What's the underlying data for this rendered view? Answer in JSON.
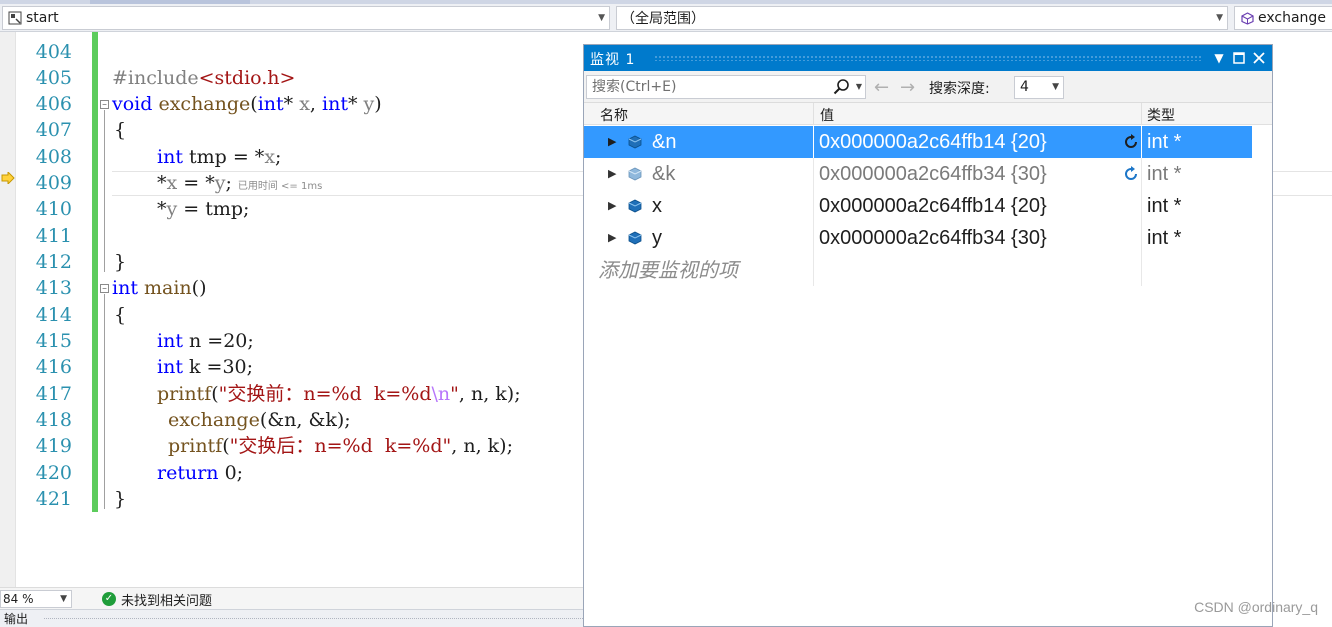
{
  "navbar": {
    "project_combo": "start",
    "scope_combo": "（全局范围）",
    "member_combo": "exchange"
  },
  "editor": {
    "line_numbers": [
      "404",
      "405",
      "406",
      "407",
      "408",
      "409",
      "410",
      "411",
      "412",
      "413",
      "414",
      "415",
      "416",
      "417",
      "418",
      "419",
      "420",
      "421"
    ],
    "code": {
      "l405_kw": "#include",
      "l405_hdr": "<stdio.h>",
      "l406_a": "void",
      "l406_b": "exchange",
      "l406_c": "(",
      "l406_d": "int",
      "l406_e": "* ",
      "l406_f": "x",
      "l406_g": ", ",
      "l406_h": "int",
      "l406_i": "* ",
      "l406_j": "y",
      "l406_k": ")",
      "l407": "{",
      "l408_a": "int",
      "l408_b": " tmp = *",
      "l408_c": "x",
      "l408_d": ";",
      "l409_a": "*",
      "l409_b": "x",
      "l409_c": " = *",
      "l409_d": "y",
      "l409_e": ";",
      "l409_perf": "已用时间 <= 1ms",
      "l410_a": "*",
      "l410_b": "y",
      "l410_c": " = tmp;",
      "l412": "}",
      "l413_a": "int",
      "l413_b": " ",
      "l413_c": "main",
      "l413_d": "()",
      "l414": "{",
      "l415_a": "int",
      "l415_b": " n =20;",
      "l416_a": "int",
      "l416_b": " k =30;",
      "l417_a": "printf",
      "l417_b": "(",
      "l417_c": "\"交换前：n=%d  k=%d",
      "l417_d": "\\n",
      "l417_e": "\"",
      "l417_f": ", n, k);",
      "l418_a": "exchange",
      "l418_b": "(&n, &k);",
      "l419_a": "printf",
      "l419_b": "(",
      "l419_c": "\"交换后：n=%d  k=%d\"",
      "l419_d": ", n, k);",
      "l420_a": "return",
      "l420_b": " 0;",
      "l421": "}"
    }
  },
  "statusbar": {
    "zoom": "84 %",
    "issues": "未找到相关问题",
    "output_tab": "输出"
  },
  "watch": {
    "title": "监视 1",
    "search_placeholder": "搜索(Ctrl+E)",
    "depth_label": "搜索深度:",
    "depth_value": "4",
    "columns": {
      "name": "名称",
      "value": "值",
      "type": "类型"
    },
    "rows": [
      {
        "name": "&n",
        "value": "0x000000a2c64ffb14 {20}",
        "type": "int *",
        "selected": true,
        "refresh": true
      },
      {
        "name": "&k",
        "value": "0x000000a2c64ffb34 {30}",
        "type": "int *",
        "selected": false,
        "refresh": true
      },
      {
        "name": "x",
        "value": "0x000000a2c64ffb14 {20}",
        "type": "int *",
        "selected": false,
        "refresh": false
      },
      {
        "name": "y",
        "value": "0x000000a2c64ffb34 {30}",
        "type": "int *",
        "selected": false,
        "refresh": false
      }
    ],
    "add_item": "添加要监视的项"
  },
  "watermark": "CSDN @ordinary_q",
  "colors": {
    "accent": "#007acc",
    "selection": "#3399ff",
    "keyword": "#0000ff",
    "string": "#a31515",
    "line_number": "#2b91af",
    "change_bar": "#5ccc5c"
  }
}
